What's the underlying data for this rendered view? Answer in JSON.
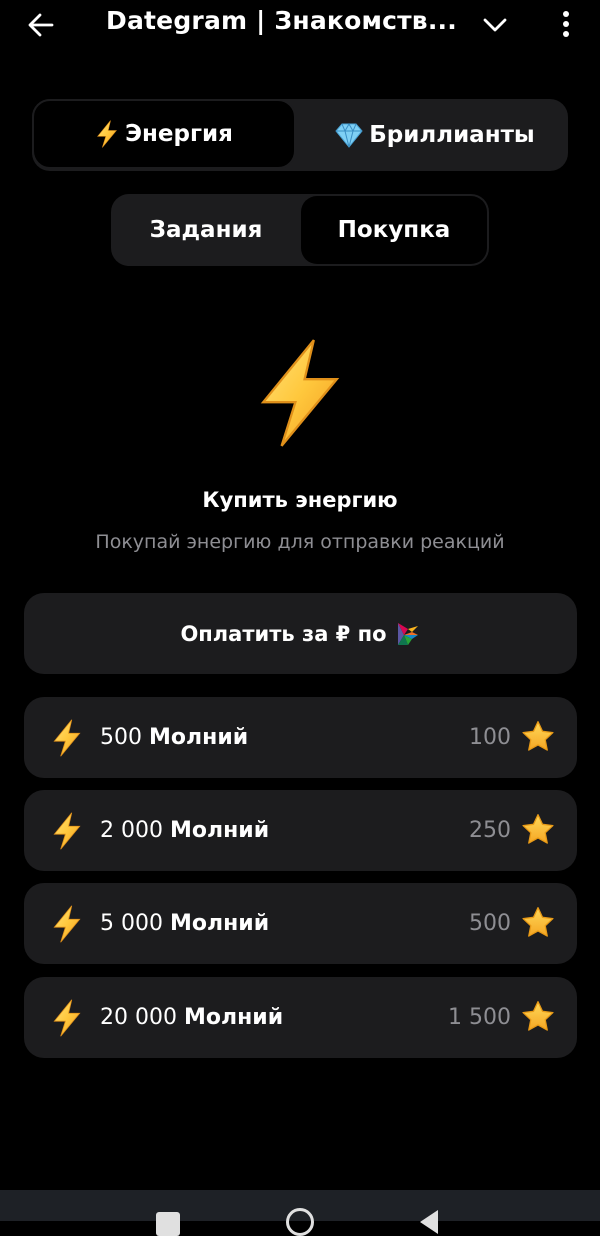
{
  "header": {
    "title": "Dategram | Знакомств..."
  },
  "tabs": {
    "energy_label": "Энергия",
    "diamonds_label": "Бриллианты",
    "active": "energy"
  },
  "subtabs": {
    "tasks_label": "Задания",
    "buy_label": "Покупка",
    "active": "buy"
  },
  "hero": {
    "title": "Купить энергию",
    "subtitle": "Покупай энергию для отправки реакций"
  },
  "pay_button": {
    "label": "Оплатить за ₽ по"
  },
  "packages": [
    {
      "amount": "500",
      "unit": "Молний",
      "price": "100"
    },
    {
      "amount": "2 000",
      "unit": "Молний",
      "price": "250"
    },
    {
      "amount": "5 000",
      "unit": "Молний",
      "price": "500"
    },
    {
      "amount": "20 000",
      "unit": "Молний",
      "price": "1 500"
    }
  ],
  "colors": {
    "background": "#000000",
    "card": "#1c1c1e",
    "muted_text": "#8e8e93",
    "bolt_yellow": "#ffc83d",
    "star_yellow": "#f8b11d"
  },
  "icons": {
    "back": "arrow-left-icon",
    "dropdown": "chevron-down-icon",
    "menu": "more-vertical-icon",
    "energy": "lightning-icon",
    "diamond": "gem-icon",
    "price": "star-icon",
    "payment": "sbp-logo-icon"
  }
}
